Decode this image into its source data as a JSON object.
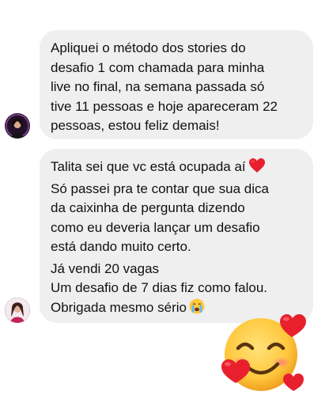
{
  "messages": [
    {
      "lines": [
        "Apliquei o método dos stories do",
        "desafio 1 com chamada para minha",
        "live no final, na semana passada só",
        "tive 11 pessoas  e hoje apareceram 22",
        "pessoas, estou feliz demais!"
      ]
    },
    {
      "lines": [
        "Talita sei que vc está ocupada aí",
        "Só passei pra te contar que sua dica",
        "da caixinha de pergunta dizendo",
        "como eu deveria lançar um desafio",
        "está dando muito certo.",
        "Já vendi 20 vagas",
        "Um desafio de 7 dias fiz como falou.",
        "Obrigada mesmo sério"
      ],
      "inline_icons": [
        "red-heart-icon",
        "crying-face-icon"
      ]
    }
  ],
  "sticker": "smiling-face-with-hearts-icon",
  "colors": {
    "bubble": "#efefef",
    "text": "#111111",
    "heart": "#e8202e",
    "emoji_face": "#ffc83d"
  }
}
